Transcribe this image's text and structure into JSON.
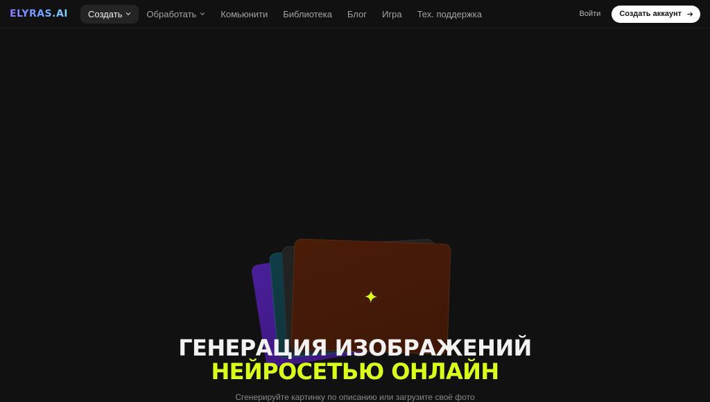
{
  "logo": "ELYRAS.AI",
  "nav": {
    "items": [
      {
        "label": "Создать",
        "dropdown": true,
        "active": true
      },
      {
        "label": "Обработать",
        "dropdown": true,
        "active": false
      },
      {
        "label": "Комьюнити",
        "dropdown": false,
        "active": false
      },
      {
        "label": "Библиотека",
        "dropdown": false,
        "active": false
      },
      {
        "label": "Блог",
        "dropdown": false,
        "active": false
      },
      {
        "label": "Игра",
        "dropdown": false,
        "active": false
      },
      {
        "label": "Тех. поддержка",
        "dropdown": false,
        "active": false
      }
    ],
    "login_label": "Войти",
    "signup_label": "Создать аккаунт"
  },
  "hero": {
    "title_line1": "ГЕНЕРАЦИЯ ИЗОБРАЖЕНИЙ",
    "title_line2": "НЕЙРОСЕТЬЮ ОНЛАЙН",
    "subtitle": "Сгенерируйте картинку по описанию или загрузите своё фото"
  },
  "colors": {
    "background": "#111111",
    "accent": "#d9ff1a",
    "card_purple": "#4a1f9a",
    "card_teal": "#0f3d47",
    "card_gray": "#222222",
    "card_main": "#4a1c08"
  },
  "icons": {
    "dropdown": "chevron-down-icon",
    "signup_arrow": "arrow-right-icon",
    "sparkle": "sparkle-icon"
  }
}
